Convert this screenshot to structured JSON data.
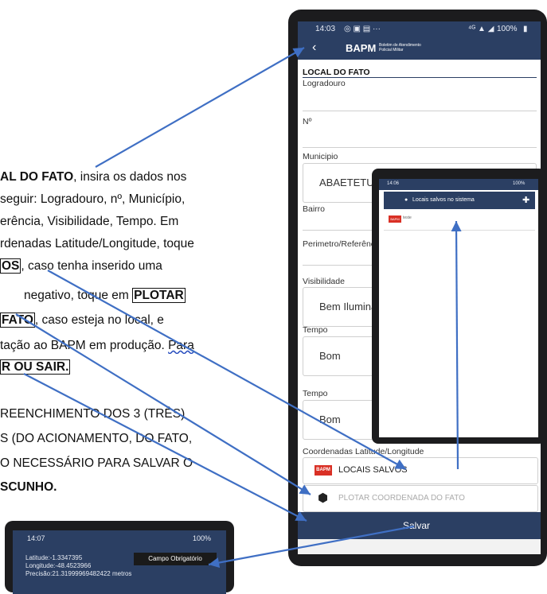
{
  "doc": {
    "line1a": "AL DO FATO",
    "line1b": ", insira os dados nos",
    "line2": "seguir: Logradouro, nº, Município,",
    "line3": "erência, Visibilidade, Tempo.  Em",
    "line4": "rdenadas Latitude/Longitude, toque",
    "line5a": "OS",
    "line5b": ", caso tenha inserido uma",
    "line6a": "negativo, toque em ",
    "line6b": "PLOTAR",
    "line7a": "FATO",
    "line7b": ", caso esteja no local, e",
    "line8a": "tação ao BAPM em produção. ",
    "line8b": "Para",
    "line9": "R OU SAIR.",
    "line10": "REENCHIMENTO DOS 3 (TRÊS)",
    "line11": "S (DO ACIONAMENTO, DO FATO,",
    "line12": "O NECESSÁRIO PARA SALVAR O",
    "line13": "SCUNHO."
  },
  "phone": {
    "status_time": "14:03",
    "status_right": "100%",
    "app_title": "BAPM",
    "app_subtitle": "Boletim de Atendimento Policial Militar",
    "section_title": "LOCAL DO FATO",
    "logradouro_label": "Logradouro",
    "numero_label": "Nº",
    "municipio_label": "Municipio",
    "municipio_value": "ABAETETUBA",
    "bairro_label": "Bairro",
    "perimetro_label": "Perimetro/Referência",
    "visibilidade_label": "Visibilidade",
    "visibilidade_value": "Bem Iluminado",
    "tempo_label": "Tempo",
    "tempo_value": "Bom",
    "tempo2_label": "Tempo",
    "tempo2_value": "Bom",
    "coords_label": "Coordenadas Latitude/Longitude",
    "locais_salvos_label": "LOCAIS SALVOS",
    "plotar_label": "PLOTAR COORDENADA DO FATO",
    "salvar_label": "Salvar",
    "bapm_badge": "BAPM"
  },
  "overlay": {
    "status_time": "14:06",
    "status_right": "100%",
    "title": "Locais salvos no sistema",
    "item_badge": "BAPM",
    "item_text": "teste"
  },
  "bottom_phone": {
    "status_time": "14:07",
    "status_right": "100%",
    "latitude": "Latitude:-1.3347395",
    "longitude": "Longitude:-48.4523966",
    "precisao": "Precisão:21.31999969482422 metros",
    "button_label": "Campo Obrigatório"
  },
  "colors": {
    "appbar": "#2b3f63",
    "arrow": "#3f6fc4",
    "badge": "#d93025"
  }
}
